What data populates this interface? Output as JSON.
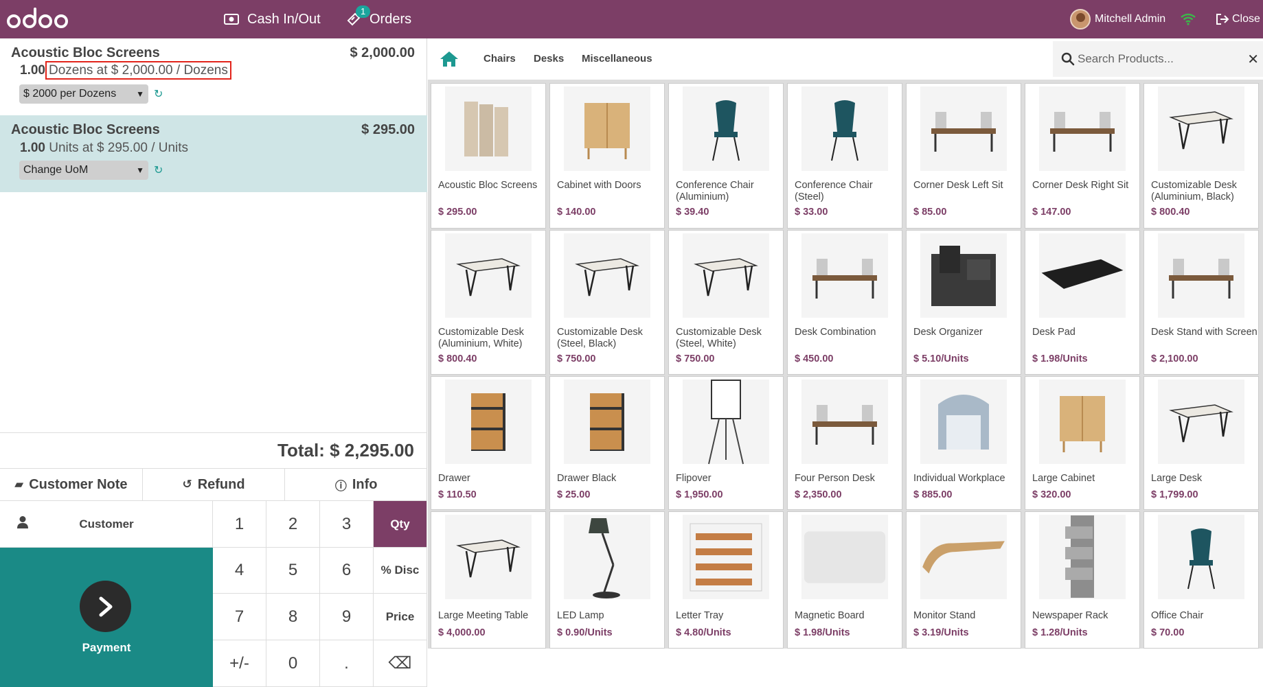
{
  "header": {
    "logo_text": "odoo",
    "cash_label": "Cash In/Out",
    "orders_label": "Orders",
    "orders_badge": "1",
    "user_name": "Mitchell Admin",
    "close_label": "Close",
    "colors": {
      "bar": "#7c3e66",
      "badge": "#1aa59d",
      "wifi": "#3cb64b"
    }
  },
  "order_lines": [
    {
      "product": "Acoustic Bloc Screens",
      "price": "$ 2,000.00",
      "qty": "1.00",
      "unit_info": "Dozens at $ 2,000.00 / Dozens",
      "uom_select": "$ 2000 per Dozens",
      "selected": false
    },
    {
      "product": "Acoustic Bloc Screens",
      "price": "$ 295.00",
      "qty": "1.00",
      "unit_info": "Units at $ 295.00 / Units",
      "uom_select": "Change UoM",
      "selected": true
    }
  ],
  "total": "Total: $ 2,295.00",
  "controls": {
    "customer_note": "Customer Note",
    "refund": "Refund",
    "info": "Info"
  },
  "customer_label": "Customer",
  "payment_label": "Payment",
  "numpad": [
    "1",
    "2",
    "3",
    "Qty",
    "4",
    "5",
    "6",
    "% Disc",
    "7",
    "8",
    "9",
    "Price",
    "+/-",
    "0",
    ".",
    "⌫"
  ],
  "categories": [
    "Chairs",
    "Desks",
    "Miscellaneous"
  ],
  "search": {
    "placeholder": "Search Products..."
  },
  "products": [
    {
      "name": "Acoustic Bloc Screens",
      "price": "$ 295.00",
      "icon": "screen-icon"
    },
    {
      "name": "Cabinet with Doors",
      "price": "$ 140.00",
      "icon": "cabinet-icon"
    },
    {
      "name": "Conference Chair (Aluminium)",
      "price": "$ 39.40",
      "icon": "chair-icon"
    },
    {
      "name": "Conference Chair (Steel)",
      "price": "$ 33.00",
      "icon": "chair-icon"
    },
    {
      "name": "Corner Desk Left Sit",
      "price": "$ 85.00",
      "icon": "desk-icon"
    },
    {
      "name": "Corner Desk Right Sit",
      "price": "$ 147.00",
      "icon": "desk-icon"
    },
    {
      "name": "Customizable Desk (Aluminium, Black)",
      "price": "$ 800.40",
      "icon": "table-icon"
    },
    {
      "name": "Customizable Desk (Aluminium, White)",
      "price": "$ 800.40",
      "icon": "table-icon"
    },
    {
      "name": "Customizable Desk (Steel, Black)",
      "price": "$ 750.00",
      "icon": "table-icon"
    },
    {
      "name": "Customizable Desk (Steel, White)",
      "price": "$ 750.00",
      "icon": "table-icon"
    },
    {
      "name": "Desk Combination",
      "price": "$ 450.00",
      "icon": "desk-icon"
    },
    {
      "name": "Desk Organizer",
      "price": "$ 5.10/Units",
      "icon": "organizer-icon"
    },
    {
      "name": "Desk Pad",
      "price": "$ 1.98/Units",
      "icon": "pad-icon"
    },
    {
      "name": "Desk Stand with Screen",
      "price": "$ 2,100.00",
      "icon": "desk-icon"
    },
    {
      "name": "Drawer",
      "price": "$ 110.50",
      "icon": "drawer-icon"
    },
    {
      "name": "Drawer Black",
      "price": "$ 25.00",
      "icon": "drawer-icon"
    },
    {
      "name": "Flipover",
      "price": "$ 1,950.00",
      "icon": "flipchart-icon"
    },
    {
      "name": "Four Person Desk",
      "price": "$ 2,350.00",
      "icon": "desk-icon"
    },
    {
      "name": "Individual Workplace",
      "price": "$ 885.00",
      "icon": "booth-icon"
    },
    {
      "name": "Large Cabinet",
      "price": "$ 320.00",
      "icon": "cabinet-icon"
    },
    {
      "name": "Large Desk",
      "price": "$ 1,799.00",
      "icon": "table-icon"
    },
    {
      "name": "Large Meeting Table",
      "price": "$ 4,000.00",
      "icon": "table-icon"
    },
    {
      "name": "LED Lamp",
      "price": "$ 0.90/Units",
      "icon": "lamp-icon"
    },
    {
      "name": "Letter Tray",
      "price": "$ 4.80/Units",
      "icon": "tray-icon"
    },
    {
      "name": "Magnetic Board",
      "price": "$ 1.98/Units",
      "icon": "board-icon"
    },
    {
      "name": "Monitor Stand",
      "price": "$ 3.19/Units",
      "icon": "stand-icon"
    },
    {
      "name": "Newspaper Rack",
      "price": "$ 1.28/Units",
      "icon": "rack-icon"
    },
    {
      "name": "Office Chair",
      "price": "$ 70.00",
      "icon": "chair-icon"
    }
  ]
}
